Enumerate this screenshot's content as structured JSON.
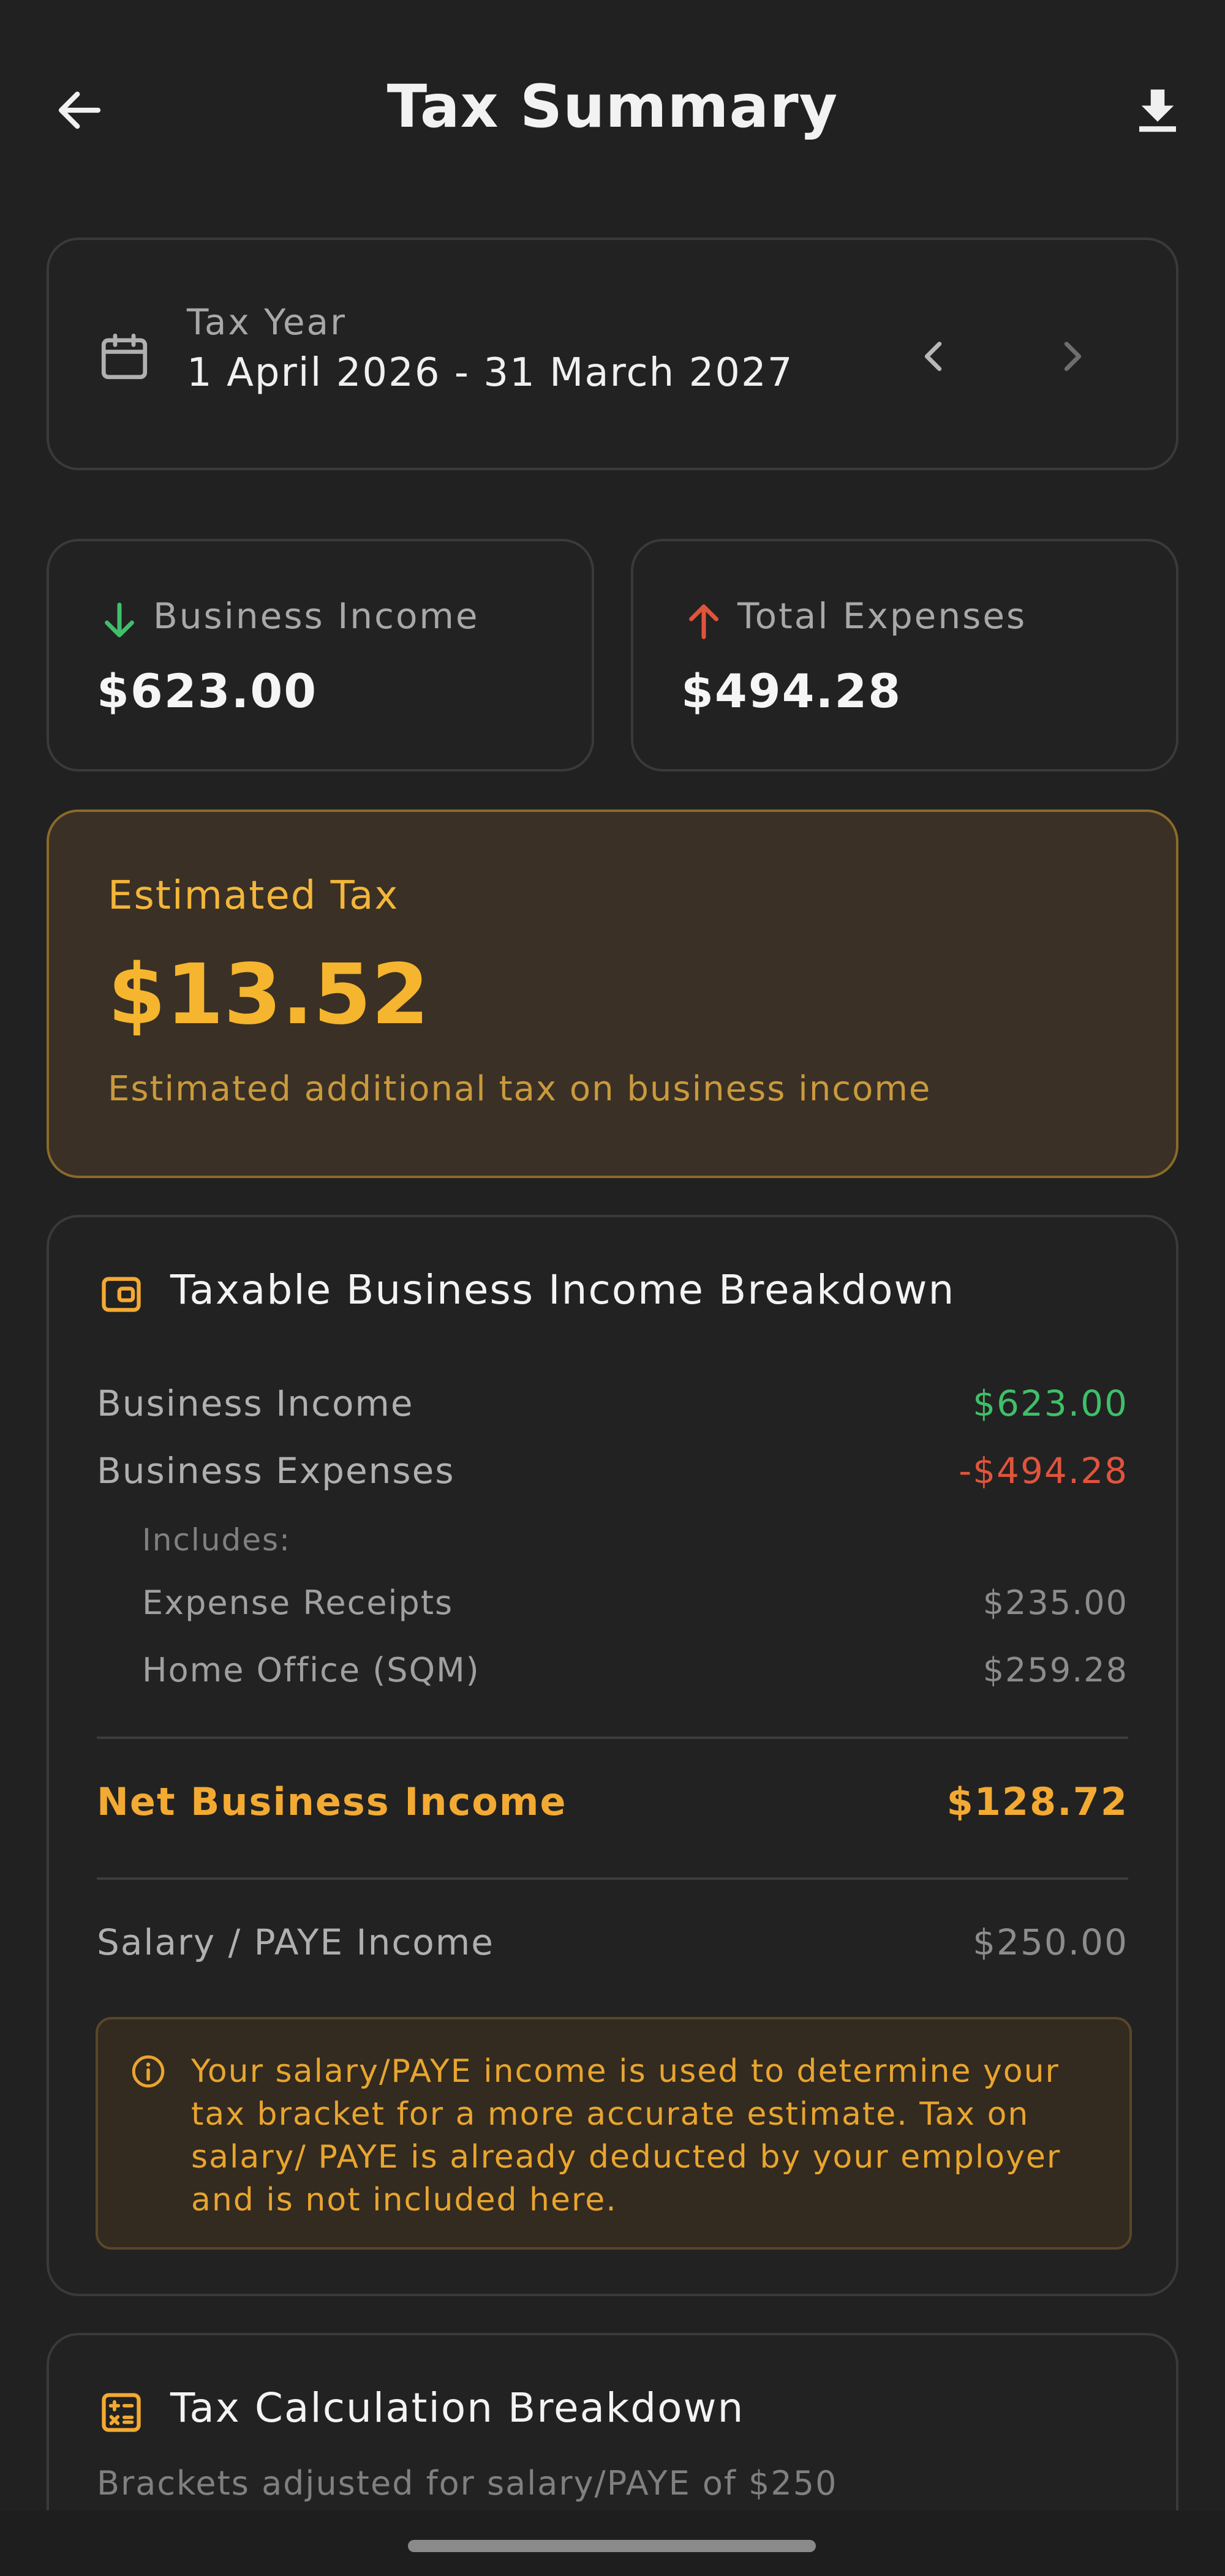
{
  "header": {
    "title": "Tax Summary",
    "back_icon": "arrow-left-icon",
    "download_icon": "download-icon"
  },
  "tax_year": {
    "label": "Tax Year",
    "range": "1 April 2026 - 31 March 2027"
  },
  "stats": {
    "income_label": "Business Income",
    "income_value": "$623.00",
    "expenses_label": "Total Expenses",
    "expenses_value": "$494.28"
  },
  "estimated": {
    "label": "Estimated Tax",
    "value": "$13.52",
    "subtitle": "Estimated additional tax on business income"
  },
  "breakdown": {
    "title": "Taxable Business Income Breakdown",
    "income_label": "Business Income",
    "income_value": "$623.00",
    "expenses_label": "Business Expenses",
    "expenses_value": "-$494.28",
    "includes_label": "Includes:",
    "receipts_label": "Expense Receipts",
    "receipts_value": "$235.00",
    "home_office_label": "Home Office (SQM)",
    "home_office_value": "$259.28",
    "net_label": "Net Business Income",
    "net_value": "$128.72",
    "salary_label": "Salary / PAYE Income",
    "salary_value": "$250.00",
    "info_text": "Your salary/PAYE income is used to determine your tax bracket for a more accurate estimate. Tax on salary/ PAYE is already deducted by your employer and is not included here."
  },
  "calculation": {
    "title": "Tax Calculation Breakdown",
    "subtitle": "Brackets adjusted for salary/PAYE of $250"
  },
  "colors": {
    "background": "#212121",
    "accent": "#f5b52e",
    "positive": "#3fbf6a",
    "negative": "#e0543c"
  }
}
